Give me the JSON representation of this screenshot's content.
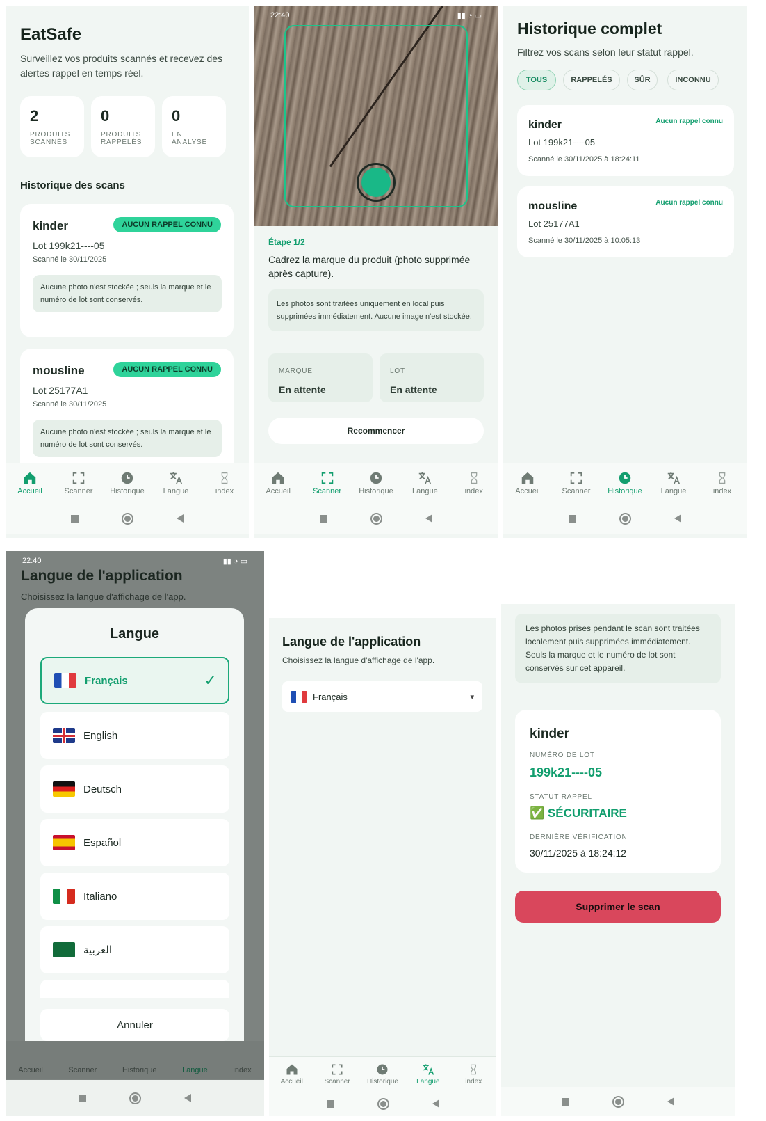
{
  "nav": {
    "items": [
      "Accueil",
      "Scanner",
      "Historique",
      "Langue",
      "index"
    ]
  },
  "home": {
    "title": "EatSafe",
    "subtitle": "Surveillez vos produits scannés et recevez des alertes rappel en temps réel.",
    "stats": [
      {
        "value": "2",
        "label_line1": "PRODUITS",
        "label_line2": "SCANNÉS"
      },
      {
        "value": "0",
        "label_line1": "PRODUITS",
        "label_line2": "RAPPELÉS"
      },
      {
        "value": "0",
        "label_line1": "EN",
        "label_line2": "ANALYSE"
      }
    ],
    "history_title": "Historique des scans",
    "scans": [
      {
        "name": "kinder",
        "badge": "AUCUN RAPPEL CONNU",
        "lot": "Lot 199k21----05",
        "date": "Scanné le 30/11/2025",
        "note": "Aucune photo n'est stockée ; seuls la marque et le numéro de lot sont conservés."
      },
      {
        "name": "mousline",
        "badge": "AUCUN RAPPEL CONNU",
        "lot": "Lot 25177A1",
        "date": "Scanné le 30/11/2025",
        "note": "Aucune photo n'est stockée ; seuls la marque et le numéro de lot sont conservés."
      }
    ]
  },
  "scanner": {
    "status_time": "22:40",
    "step": "Étape 1/2",
    "instruction": "Cadrez la marque du produit (photo supprimée après capture).",
    "privacy_note": "Les photos sont traitées uniquement en local puis supprimées immédiatement. Aucune image n'est stockée.",
    "brand_label": "MARQUE",
    "brand_value": "En attente",
    "lot_label": "LOT",
    "lot_value": "En attente",
    "restart": "Recommencer"
  },
  "history": {
    "title": "Historique complet",
    "subtitle": "Filtrez vos scans selon leur statut rappel.",
    "filters": [
      "TOUS",
      "RAPPELÉS",
      "SÛR",
      "INCONNU"
    ],
    "items": [
      {
        "name": "kinder",
        "status": "Aucun rappel connu",
        "lot": "Lot 199k21----05",
        "date": "Scanné le 30/11/2025 à 18:24:11"
      },
      {
        "name": "mousline",
        "status": "Aucun rappel connu",
        "lot": "Lot 25177A1",
        "date": "Scanné le 30/11/2025 à 10:05:13"
      }
    ]
  },
  "lang_modal": {
    "status_time": "22:40",
    "page_title": "Langue de l'application",
    "page_subtitle": "Choisissez la langue d'affichage de l'app.",
    "title": "Langue",
    "options": [
      "Français",
      "English",
      "Deutsch",
      "Español",
      "Italiano",
      "العربية"
    ],
    "selected_mark": "✓",
    "cancel": "Annuler"
  },
  "lang_page": {
    "title": "Langue de l'application",
    "subtitle": "Choisissez la langue d'affichage de l'app.",
    "selected": "Français",
    "caret": "▾"
  },
  "detail": {
    "privacy_note": "Les photos prises pendant le scan sont traitées localement puis supprimées immédiatement. Seuls la marque et le numéro de lot sont conservés sur cet appareil.",
    "name": "kinder",
    "lot_label": "NUMÉRO DE LOT",
    "lot_value": "199k21----05",
    "status_label": "STATUT RAPPEL",
    "status_value": "✅ SÉCURITAIRE",
    "verify_label": "DERNIÈRE VÉRIFICATION",
    "verify_value": "30/11/2025 à 18:24:12",
    "delete": "Supprimer le scan"
  },
  "colors": {
    "accent": "#129e6e",
    "badge": "#2fd39a",
    "danger": "#d9475c"
  }
}
